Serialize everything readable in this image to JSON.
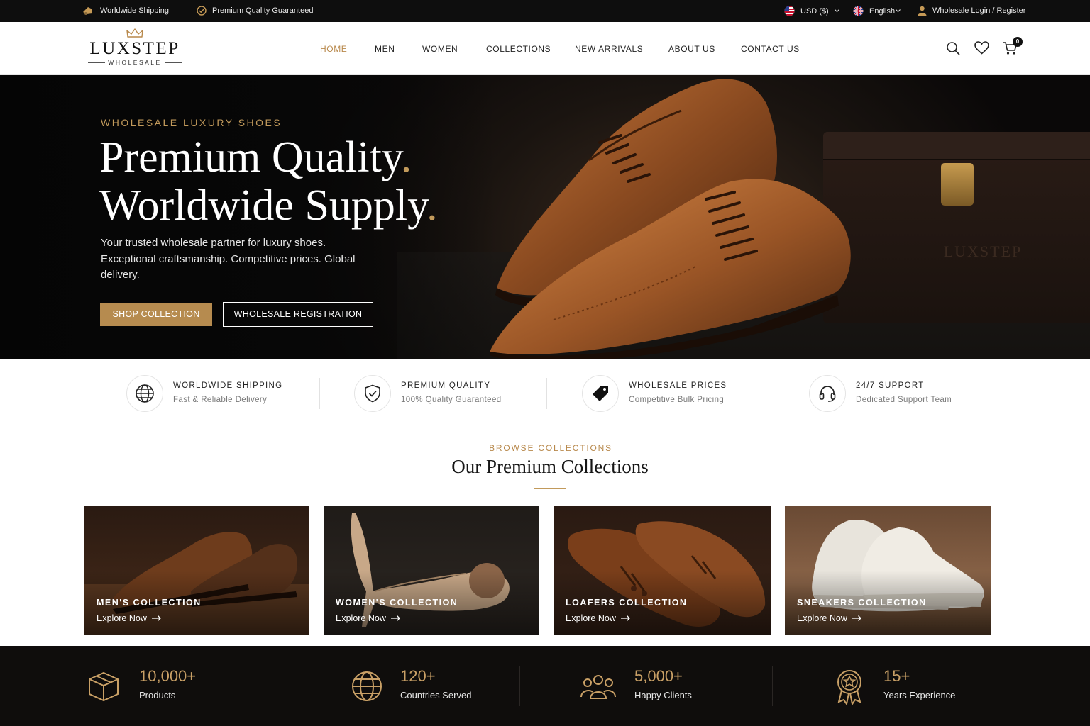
{
  "topbar": {
    "shipping": "Worldwide Shipping",
    "quality": "Premium Quality Guaranteed",
    "currency": "USD ($)",
    "language": "English",
    "account": "Wholesale Login / Register"
  },
  "brand": {
    "name": "LUXSTEP",
    "sub": "WHOLESALE"
  },
  "nav": {
    "items": [
      {
        "label": "HOME",
        "active": true
      },
      {
        "label": "MEN"
      },
      {
        "label": "WOMEN"
      },
      {
        "label": "COLLECTIONS"
      },
      {
        "label": "NEW ARRIVALS"
      },
      {
        "label": "ABOUT US"
      },
      {
        "label": "CONTACT US"
      }
    ],
    "cart_count": "0",
    "icons": [
      "search-icon",
      "heart-icon",
      "cart-icon"
    ]
  },
  "hero": {
    "tag": "WHOLESALE LUXURY SHOES",
    "title_line1": "Premium Quality",
    "title_line2": "Worldwide Supply",
    "title_dot": ".",
    "description": "Your trusted wholesale partner for luxury shoes. Exceptional craftsmanship. Competitive prices. Global delivery.",
    "primary_button": "SHOP COLLECTION",
    "secondary_button": "WHOLESALE REGISTRATION",
    "box_logo": "LUXSTEP"
  },
  "features": [
    {
      "title": "WORLDWIDE SHIPPING",
      "subtitle": "Fast & Reliable Delivery",
      "icon": "globe-icon"
    },
    {
      "title": "PREMIUM QUALITY",
      "subtitle": "100% Quality Guaranteed",
      "icon": "shield-check-icon"
    },
    {
      "title": "WHOLESALE PRICES",
      "subtitle": "Competitive Bulk Pricing",
      "icon": "price-tag-icon"
    },
    {
      "title": "24/7 SUPPORT",
      "subtitle": "Dedicated Support Team",
      "icon": "headset-icon"
    }
  ],
  "collections": {
    "tag": "BROWSE COLLECTIONS",
    "title": "Our Premium Collections",
    "cards": [
      {
        "title": "MEN'S COLLECTION",
        "cta": "Explore Now"
      },
      {
        "title": "WOMEN'S COLLECTION",
        "cta": "Explore Now"
      },
      {
        "title": "LOAFERS COLLECTION",
        "cta": "Explore Now"
      },
      {
        "title": "SNEAKERS COLLECTION",
        "cta": "Explore Now"
      }
    ]
  },
  "stats": [
    {
      "value": "10,000+",
      "label": "Products",
      "icon": "box-icon"
    },
    {
      "value": "120+",
      "label": "Countries Served",
      "icon": "globe-icon"
    },
    {
      "value": "5,000+",
      "label": "Happy Clients",
      "icon": "users-icon"
    },
    {
      "value": "15+",
      "label": "Years Experience",
      "icon": "award-icon"
    }
  ],
  "colors": {
    "accent": "#b8894c",
    "dark": "#0e0e0e",
    "gold_button": "#b68b4f"
  }
}
